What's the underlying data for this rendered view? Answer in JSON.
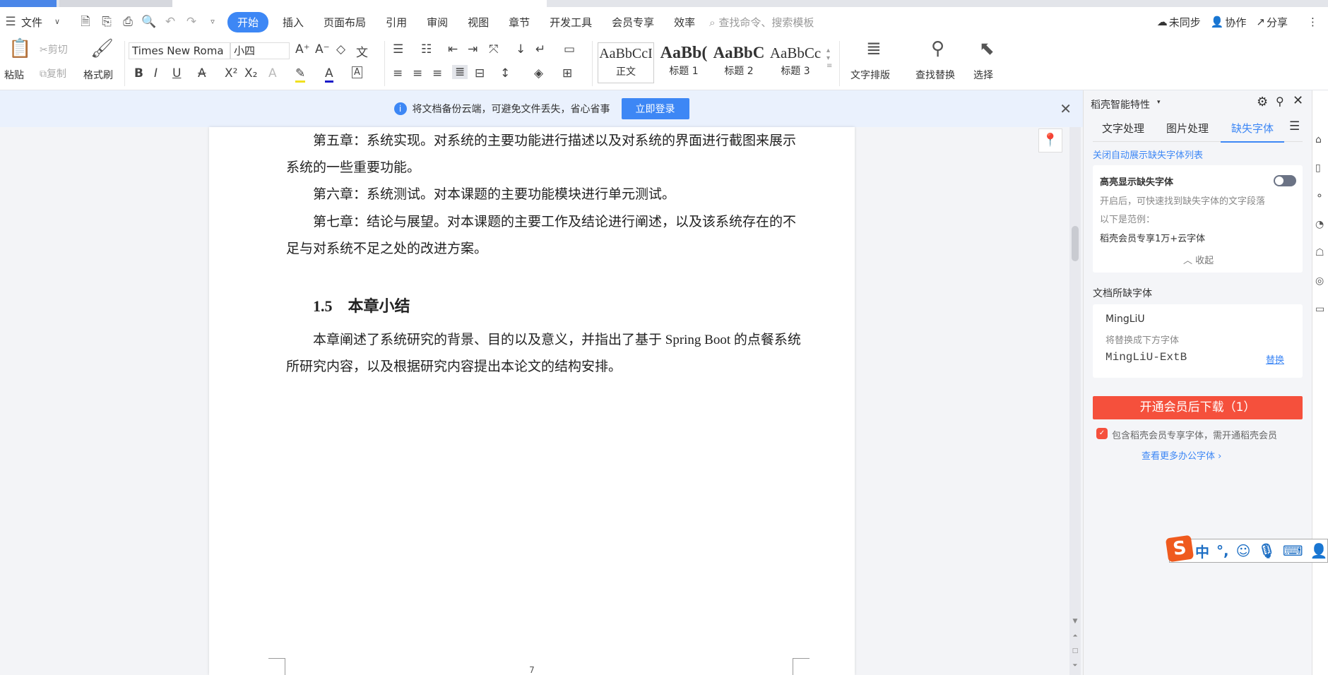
{
  "menu": {
    "file": "文件",
    "tabs": [
      "开始",
      "插入",
      "页面布局",
      "引用",
      "审阅",
      "视图",
      "章节",
      "开发工具",
      "会员专享",
      "效率"
    ],
    "search_placeholder": "查找命令、搜索模板",
    "sync": "未同步",
    "collab": "协作",
    "share": "分享"
  },
  "ribbon": {
    "paste": "粘贴",
    "cut": "剪切",
    "copy": "复制",
    "format_painter": "格式刷",
    "font_name": "Times New Roma",
    "font_size": "小四",
    "styles": [
      {
        "sample": "AaBbCcI",
        "label": "正文"
      },
      {
        "sample": "AaBb(",
        "label": "标题 1"
      },
      {
        "sample": "AaBbC",
        "label": "标题 2"
      },
      {
        "sample": "AaBbCc",
        "label": "标题 3"
      }
    ],
    "text_layout": "文字排版",
    "find_replace": "查找替换",
    "select": "选择"
  },
  "notice": {
    "text": "将文档备份云端，可避免文件丢失，省心省事",
    "login": "立即登录"
  },
  "document": {
    "paragraphs": [
      "第五章：系统实现。对系统的主要功能进行描述以及对系统的界面进行截图来展示",
      "系统的一些重要功能。",
      "第六章：系统测试。对本课题的主要功能模块进行单元测试。",
      "第七章：结论与展望。对本课题的主要工作及结论进行阐述，以及该系统存在的不",
      "足与对系统不足之处的改进方案。"
    ],
    "heading": "1.5　本章小结",
    "summary": [
      "本章阐述了系统研究的背景、目的以及意义，并指出了基于 Spring Boot 的点餐系统",
      "所研究内容，以及根据研究内容提出本论文的结构安排。"
    ],
    "page_number": "7"
  },
  "panel": {
    "title": "稻壳智能特性",
    "tabs": [
      "文字处理",
      "图片处理",
      "缺失字体"
    ],
    "close_auto": "关闭自动展示缺失字体列表",
    "highlight_label": "高亮显示缺失字体",
    "highlight_on": false,
    "desc": "开启后，可快速找到缺失字体的文字段落",
    "example_label": "以下是范例：",
    "example": "稻壳会员专享1万+云字体",
    "collapse": "收起",
    "missing_title": "文档所缺字体",
    "missing_font": "MingLiU",
    "replace_hint": "将替换成下方字体",
    "replacement_font": "MingLiU-ExtB",
    "replace": "替换",
    "download_button": "开通会员后下载（1）",
    "member_note": "包含稻壳会员专享字体，需开通稻壳会员",
    "more_fonts": "查看更多办公字体"
  },
  "ime": {
    "mode": "中",
    "punct": "°,"
  },
  "colors": {
    "accent": "#3d87f5",
    "download": "#f5503c"
  }
}
